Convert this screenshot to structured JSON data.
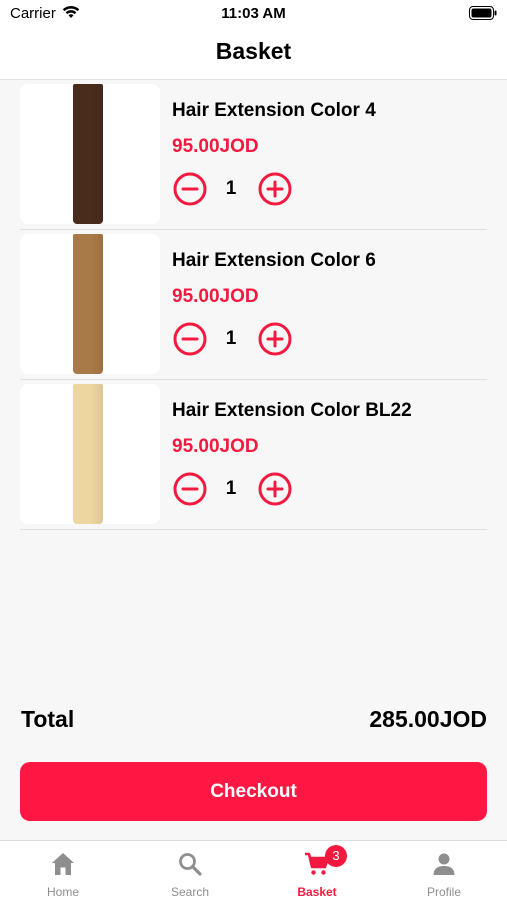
{
  "status": {
    "carrier": "Carrier",
    "time": "11:03 AM"
  },
  "header": {
    "title": "Basket"
  },
  "items": [
    {
      "name": "Hair Extension Color 4",
      "price": "95.00JOD",
      "quantity": "1",
      "swatch": "#4a2c1c"
    },
    {
      "name": "Hair Extension Color 6",
      "price": "95.00JOD",
      "quantity": "1",
      "swatch": "#a97a47"
    },
    {
      "name": "Hair Extension Color BL22",
      "price": "95.00JOD",
      "quantity": "1",
      "swatch": "#eed6a0"
    }
  ],
  "summary": {
    "total_label": "Total",
    "total_value": "285.00JOD",
    "checkout_label": "Checkout"
  },
  "tabbar": {
    "tabs": [
      {
        "label": "Home",
        "icon": "home-icon"
      },
      {
        "label": "Search",
        "icon": "search-icon"
      },
      {
        "label": "Basket",
        "icon": "cart-icon",
        "badge": "3",
        "active": true
      },
      {
        "label": "Profile",
        "icon": "person-icon"
      }
    ]
  },
  "colors": {
    "accent": "#f3193f",
    "checkout_bg": "#ff1744",
    "inactive": "#8e8e8e"
  }
}
